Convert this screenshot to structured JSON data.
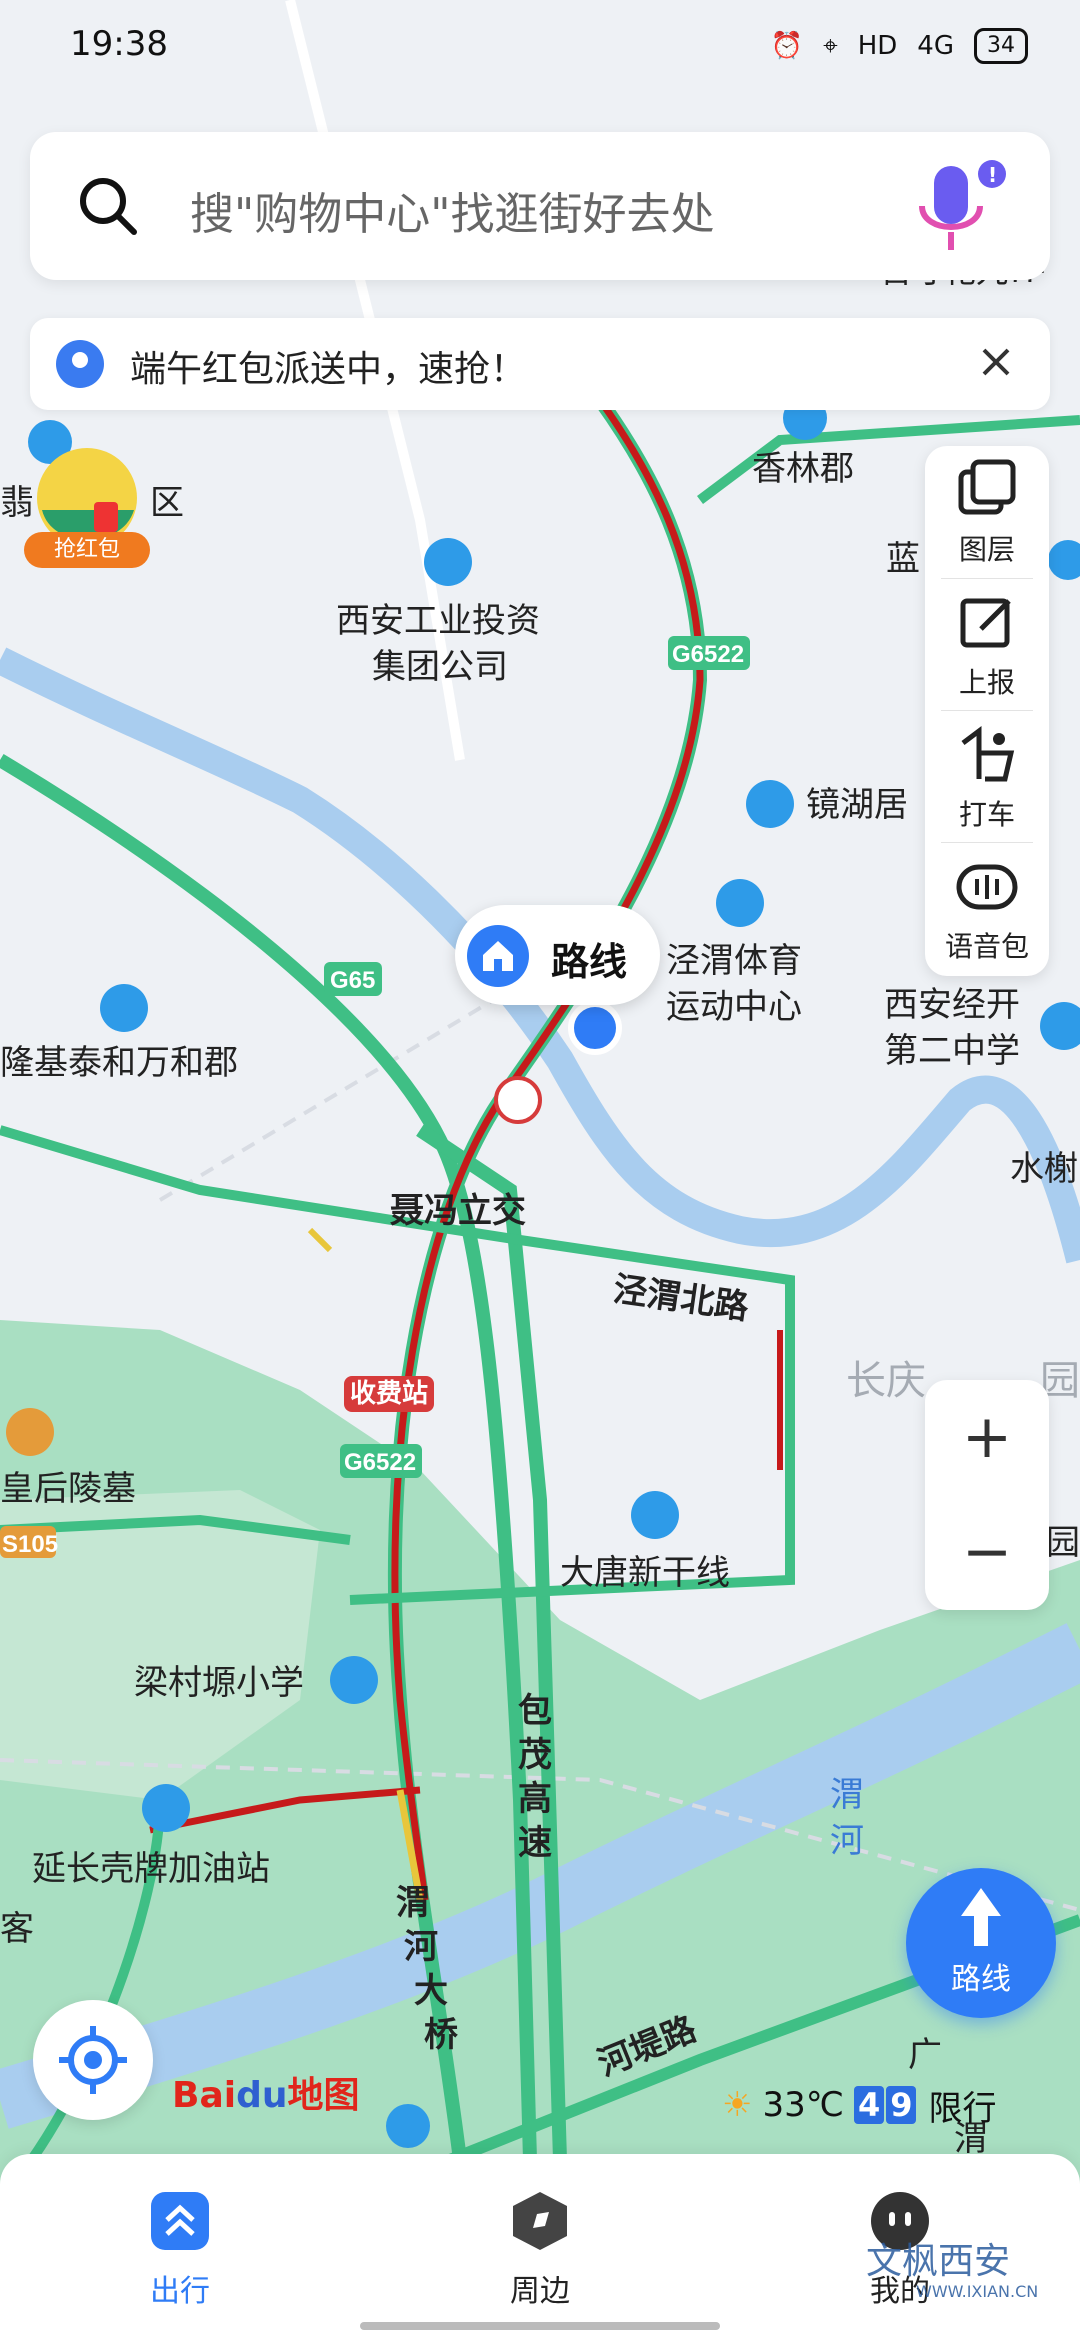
{
  "status_bar": {
    "time": "19:38",
    "network": "4G",
    "hd": "HD",
    "battery": "34"
  },
  "search": {
    "placeholder": "搜\"购物中心\"找逛街好去处"
  },
  "notice": {
    "text": "端午红包派送中，速抢！"
  },
  "promo": {
    "red_packet_label": "抢红包"
  },
  "tools": [
    {
      "label": "图层",
      "icon": "layers-icon"
    },
    {
      "label": "上报",
      "icon": "report-icon"
    },
    {
      "label": "打车",
      "icon": "taxi-icon"
    },
    {
      "label": "语音包",
      "icon": "voice-pack-icon"
    }
  ],
  "route_bubble": {
    "label": "路线"
  },
  "route_fab": {
    "label": "路线"
  },
  "zoom": {
    "in": "+",
    "out": "−"
  },
  "map_labels": {
    "xianglinjun": "香林郡",
    "lan": "蓝",
    "qu": "区",
    "weng": "翡",
    "industry_group": "西安工业投资\n集团公司",
    "jinghuju": "镜湖居",
    "sports_center": "泾渭体育\n运动中心",
    "long_ji": "隆基泰和万和郡",
    "second_school": "西安经开\n第二中学",
    "shuixie": "水榭",
    "nieping": "聂冯立交",
    "jingwei_north": "泾渭北路",
    "changqing": "长庆",
    "garden1": "园",
    "garden2": "园",
    "toll": "收费站",
    "empress": "皇后陵墓",
    "datang": "大唐新干线",
    "liangcun": "梁村塬小学",
    "gas": "延长壳牌加油站",
    "baomao": "包茂高速",
    "weihe_bridge": "渭河大桥",
    "weihe": "渭河",
    "hedi": "河堤路",
    "ke": "客",
    "guang": "广",
    "wei": "渭",
    "top_right": "百寸花九7F",
    "g6522_a": "G6522",
    "g6522_b": "G6522",
    "g65": "G65",
    "s105": "S105"
  },
  "weather": {
    "temp": "33℃",
    "restrict_label": "限行",
    "restrict_nums": [
      "4",
      "9"
    ]
  },
  "logo": {
    "baidu": "Bai",
    "du": "du",
    "map": "地图"
  },
  "bottom_nav": [
    {
      "label": "出行"
    },
    {
      "label": "周边"
    },
    {
      "label": "我的"
    }
  ],
  "watermark": {
    "text": "文枫西安",
    "url": "WWW.IXIAN.CN"
  },
  "colors": {
    "accent": "#2f7cf6",
    "road_green": "#3fbf85",
    "congestion_red": "#c61a1a",
    "water": "#a9cdef"
  }
}
